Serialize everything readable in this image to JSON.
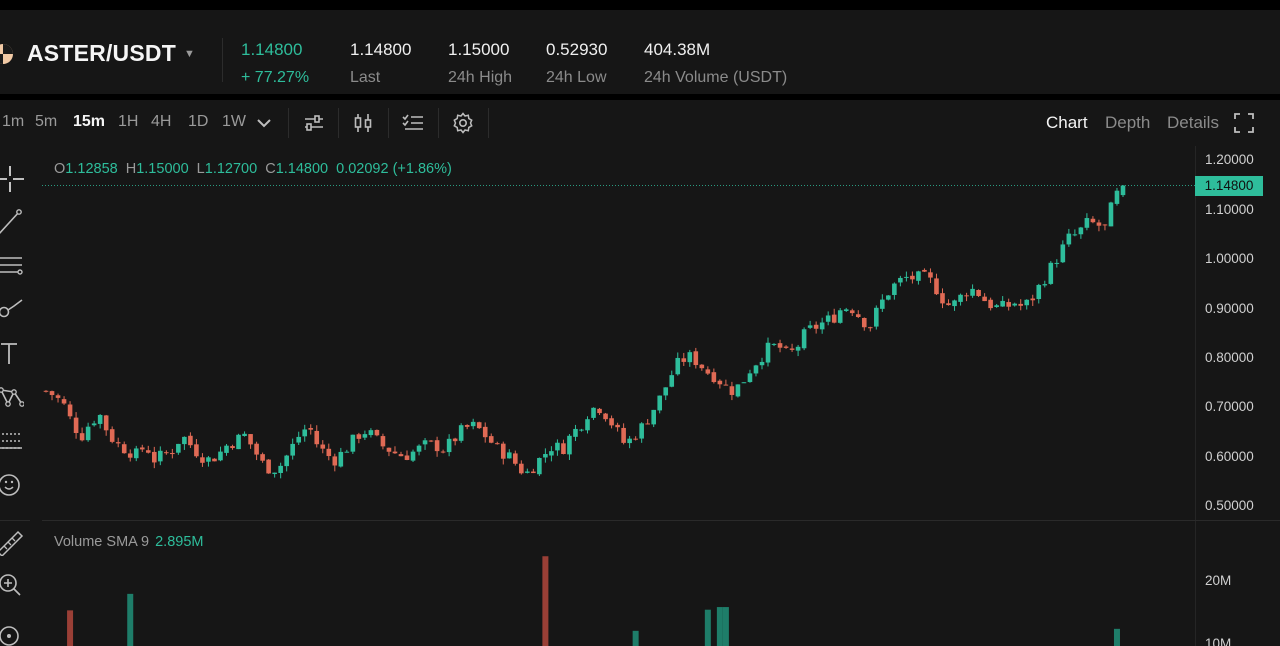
{
  "header": {
    "pair": "ASTER/USDT",
    "price": "1.14800",
    "change": "+ 77.27%",
    "stats": [
      {
        "value": "1.14800",
        "label": "Last"
      },
      {
        "value": "1.15000",
        "label": "24h High"
      },
      {
        "value": "0.52930",
        "label": "24h Low"
      },
      {
        "value": "404.38M",
        "label": "24h Volume (USDT)"
      }
    ]
  },
  "toolbar": {
    "intervals": [
      "1m",
      "5m",
      "15m",
      "1H",
      "4H",
      "1D",
      "1W"
    ],
    "active_interval": "15m",
    "views": [
      "Chart",
      "Depth",
      "Details"
    ],
    "active_view": "Chart"
  },
  "legend": {
    "o_key": "O",
    "o_val": "1.12858",
    "h_key": "H",
    "h_val": "1.15000",
    "l_key": "L",
    "l_val": "1.12700",
    "c_key": "C",
    "c_val": "1.14800",
    "chg": "0.02092 (+1.86%)"
  },
  "volume": {
    "label": "Volume SMA 9",
    "value": "2.895M"
  },
  "colors": {
    "up": "#2ebd9b",
    "down": "#e06a55",
    "bg": "#161616",
    "header_bg": "#161616"
  },
  "chart_data": {
    "type": "candlestick",
    "price_axis": {
      "ticks": [
        "1.20000",
        "1.10000",
        "1.00000",
        "0.90000",
        "0.80000",
        "0.70000",
        "0.60000",
        "0.50000"
      ],
      "range": [
        0.47,
        1.21
      ]
    },
    "volume_axis": {
      "ticks": [
        "20M",
        "10M"
      ]
    },
    "last_price": "1.14800",
    "close_path": [
      0.73,
      0.72,
      0.7,
      0.66,
      0.64,
      0.67,
      0.68,
      0.64,
      0.62,
      0.61,
      0.6,
      0.62,
      0.59,
      0.6,
      0.61,
      0.64,
      0.62,
      0.6,
      0.59,
      0.6,
      0.62,
      0.63,
      0.64,
      0.61,
      0.58,
      0.57,
      0.58,
      0.61,
      0.64,
      0.66,
      0.62,
      0.6,
      0.59,
      0.61,
      0.63,
      0.65,
      0.64,
      0.62,
      0.61,
      0.6,
      0.6,
      0.61,
      0.62,
      0.62,
      0.61,
      0.63,
      0.65,
      0.66,
      0.65,
      0.63,
      0.61,
      0.6,
      0.58,
      0.56,
      0.58,
      0.6,
      0.62,
      0.61,
      0.64,
      0.66,
      0.69,
      0.7,
      0.68,
      0.65,
      0.62,
      0.64,
      0.66,
      0.69,
      0.72,
      0.76,
      0.79,
      0.8,
      0.79,
      0.77,
      0.76,
      0.74,
      0.73,
      0.75,
      0.78,
      0.8,
      0.82,
      0.82,
      0.8,
      0.82,
      0.85,
      0.86,
      0.87,
      0.88,
      0.9,
      0.9,
      0.88,
      0.86,
      0.9,
      0.93,
      0.95,
      0.96,
      0.96,
      0.96,
      0.95,
      0.92,
      0.9,
      0.92,
      0.94,
      0.93,
      0.91,
      0.9,
      0.9,
      0.91,
      0.9,
      0.92,
      0.95,
      0.98,
      1.01,
      1.04,
      1.05,
      1.07,
      1.07,
      1.06,
      1.12,
      1.148
    ],
    "volume_bars": [
      {
        "index": 4,
        "value": 10.8,
        "dir": "down"
      },
      {
        "index": 14,
        "value": 15.8,
        "dir": "up"
      },
      {
        "index": 83,
        "value": 27.2,
        "dir": "down"
      },
      {
        "index": 98,
        "value": 4.6,
        "dir": "up"
      },
      {
        "index": 110,
        "value": 11.0,
        "dir": "up"
      },
      {
        "index": 112,
        "value": 11.8,
        "dir": "up"
      },
      {
        "index": 113,
        "value": 11.8,
        "dir": "up"
      },
      {
        "index": 178,
        "value": 5.2,
        "dir": "up"
      }
    ]
  }
}
